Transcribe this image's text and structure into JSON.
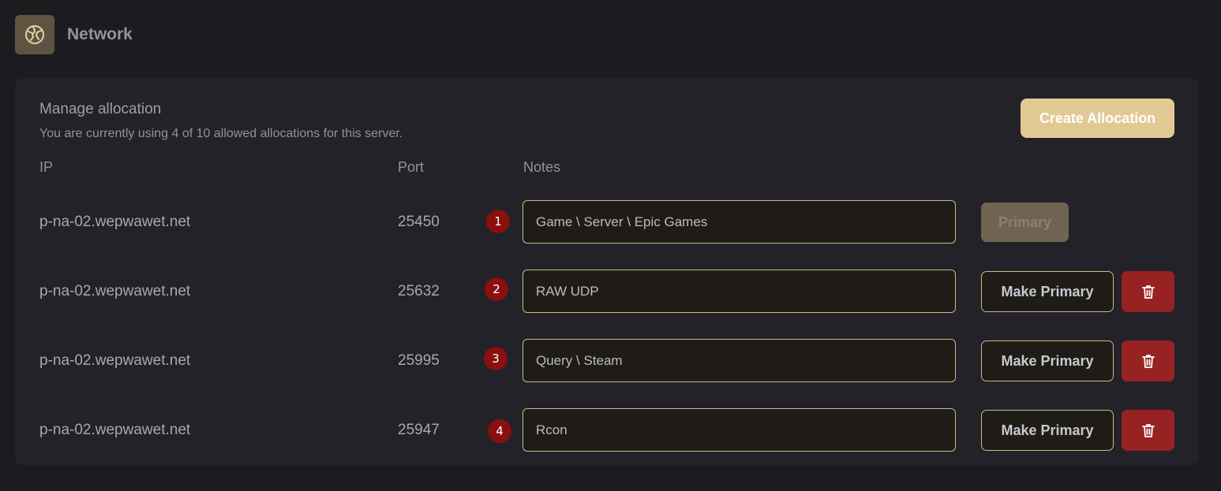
{
  "header": {
    "title": "Network",
    "icon": "network-icon"
  },
  "panel": {
    "title": "Manage allocation",
    "subtitle": "You are currently using 4 of 10 allowed allocations for this server.",
    "create_label": "Create Allocation"
  },
  "columns": {
    "ip": "IP",
    "port": "Port",
    "notes": "Notes"
  },
  "rows": [
    {
      "badge": "1",
      "ip": "p-na-02.wepwawet.net",
      "port": "25450",
      "notes": "Game \\ Server \\ Epic Games",
      "action": "Primary",
      "is_primary": true
    },
    {
      "badge": "2",
      "ip": "p-na-02.wepwawet.net",
      "port": "25632",
      "notes": "RAW UDP",
      "action": "Make Primary",
      "is_primary": false
    },
    {
      "badge": "3",
      "ip": "p-na-02.wepwawet.net",
      "port": "25995",
      "notes": "Query \\ Steam",
      "action": "Make Primary",
      "is_primary": false
    },
    {
      "badge": "4",
      "ip": "p-na-02.wepwawet.net",
      "port": "25947",
      "notes": "Rcon",
      "action": "Make Primary",
      "is_primary": false
    }
  ],
  "colors": {
    "accent": "#e2c994",
    "danger": "#972222",
    "badge": "#8a0f0f"
  }
}
